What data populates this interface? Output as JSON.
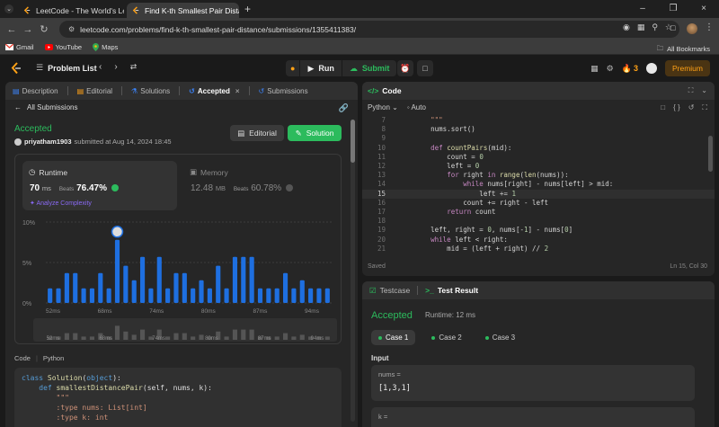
{
  "browser": {
    "tabs": [
      {
        "title": "LeetCode - The World's Leadin"
      },
      {
        "title": "Find K-th Smallest Pair Distance"
      }
    ],
    "url": "leetcode.com/problems/find-k-th-smallest-pair-distance/submissions/1355411383/",
    "bookmarks": [
      "Gmail",
      "YouTube",
      "Maps"
    ],
    "all_bookmarks": "All Bookmarks"
  },
  "header": {
    "problem_list": "Problem List",
    "run": "Run",
    "submit": "Submit",
    "streak": "3",
    "premium": "Premium"
  },
  "left": {
    "tabs": [
      "Description",
      "Editorial",
      "Solutions",
      "Accepted",
      "Submissions"
    ],
    "all_submissions": "All Submissions",
    "status": "Accepted",
    "user": "priyatham1903",
    "submitted_at": "submitted at Aug 14, 2024 18:45",
    "editorial_btn": "Editorial",
    "solution_btn": "Solution",
    "runtime": {
      "title": "Runtime",
      "value": "70",
      "unit": "ms",
      "beats_label": "Beats",
      "beats": "76.47%"
    },
    "analyze": "Analyze Complexity",
    "memory": {
      "title": "Memory",
      "value": "12.48",
      "unit": "MB",
      "beats_label": "Beats",
      "beats": "60.78%"
    },
    "code_tab": "Code",
    "code_lang": "Python",
    "code_lines": [
      "class Solution(object):",
      "    def smallestDistancePair(self, nums, k):",
      "        \"\"\"",
      "        :type nums: List[int]",
      "        :type k: int"
    ]
  },
  "chart_data": {
    "type": "bar",
    "ylabel_ticks": [
      "10%",
      "5%",
      "0%"
    ],
    "ylim": [
      0,
      10
    ],
    "x_tick_labels": [
      "52ms",
      "68ms",
      "74ms",
      "80ms",
      "87ms",
      "94ms"
    ],
    "values": [
      1.8,
      1.8,
      3.7,
      3.7,
      1.8,
      1.8,
      3.7,
      1.8,
      7.8,
      4.6,
      2.8,
      5.7,
      1.8,
      5.7,
      1.8,
      3.7,
      3.7,
      1.8,
      2.8,
      1.8,
      4.6,
      1.8,
      5.7,
      5.7,
      5.7,
      1.8,
      1.8,
      1.8,
      3.7,
      1.8,
      2.8,
      1.8,
      1.8,
      1.8
    ],
    "highlight_index": 8,
    "bar_color": "#1e6fe0"
  },
  "editor": {
    "title": "Code",
    "language": "Python",
    "mode": "Auto",
    "lines": [
      {
        "n": "7",
        "t": "        \"\"\""
      },
      {
        "n": "8",
        "t": "        nums.sort()"
      },
      {
        "n": "9",
        "t": ""
      },
      {
        "n": "10",
        "t": "        def countPairs(mid):"
      },
      {
        "n": "11",
        "t": "            count = 0"
      },
      {
        "n": "12",
        "t": "            left = 0"
      },
      {
        "n": "13",
        "t": "            for right in range(len(nums)):"
      },
      {
        "n": "14",
        "t": "                while nums[right] - nums[left] > mid:"
      },
      {
        "n": "15",
        "t": "                    left += 1"
      },
      {
        "n": "16",
        "t": "                count += right - left"
      },
      {
        "n": "17",
        "t": "            return count"
      },
      {
        "n": "18",
        "t": ""
      },
      {
        "n": "19",
        "t": "        left, right = 0, nums[-1] - nums[0]"
      },
      {
        "n": "20",
        "t": "        while left < right:"
      },
      {
        "n": "21",
        "t": "            mid = (left + right) // 2"
      }
    ],
    "current_line": "15",
    "saved": "Saved",
    "cursor": "Ln 15, Col 30"
  },
  "result": {
    "tabs": [
      "Testcase",
      "Test Result"
    ],
    "status": "Accepted",
    "runtime": "Runtime: 12 ms",
    "cases": [
      "Case 1",
      "Case 2",
      "Case 3"
    ],
    "input_label": "Input",
    "nums_label": "nums =",
    "nums_value": "[1,3,1]",
    "k_label": "k ="
  }
}
